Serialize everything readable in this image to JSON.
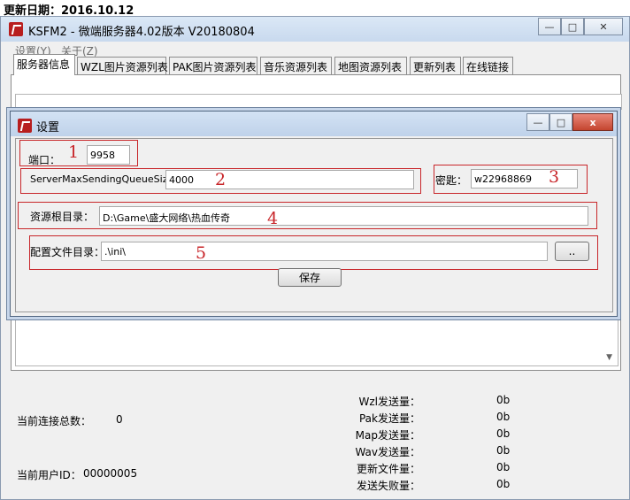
{
  "update_date": "更新日期：2016.10.12",
  "window": {
    "title": "KSFM2 - 微端服务器4.02版本 V20180804",
    "controls": {
      "minimize": "—",
      "maximize": "□",
      "close": "✕"
    }
  },
  "menu": [
    {
      "label": "设置(Y)"
    },
    {
      "label": "关于(Z)"
    }
  ],
  "tabs": [
    {
      "label": "服务器信息",
      "active": true
    },
    {
      "label": "WZL图片资源列表"
    },
    {
      "label": "PAK图片资源列表"
    },
    {
      "label": "音乐资源列表"
    },
    {
      "label": "地图资源列表"
    },
    {
      "label": "更新列表"
    },
    {
      "label": "在线链接"
    }
  ],
  "dialog": {
    "title": "设置",
    "controls": {
      "minimize": "—",
      "maximize": "□",
      "close": "x"
    },
    "port": {
      "label": "端口：",
      "value": "9958",
      "marker": "1"
    },
    "queue": {
      "label": "ServerMaxSendingQueueSize",
      "value": "4000",
      "marker": "2"
    },
    "password": {
      "label": "密匙：",
      "value": "w22968869",
      "marker": "3"
    },
    "resource_dir": {
      "label": "资源根目录：",
      "value": "D:\\Game\\盛大网络\\热血传奇",
      "marker": "4"
    },
    "config_dir": {
      "label": "配置文件目录：",
      "value": ".\\ini\\",
      "marker": "5",
      "browse_label": ".."
    },
    "save_label": "保存"
  },
  "status": {
    "total_connections_label": "当前连接总数：",
    "total_connections_value": "0",
    "current_user_label": "当前用户ID：",
    "current_user_value": "00000005",
    "stats": [
      {
        "label": "Wzl发送量：",
        "value": "0b"
      },
      {
        "label": "Pak发送量：",
        "value": "0b"
      },
      {
        "label": "Map发送量：",
        "value": "0b"
      },
      {
        "label": "Wav发送量：",
        "value": "0b"
      },
      {
        "label": "更新文件量：",
        "value": "0b"
      },
      {
        "label": "发送失败量：",
        "value": "0b"
      }
    ]
  },
  "colors": {
    "marker_red": "#c8262a",
    "icon_red": "#b81e1e"
  }
}
